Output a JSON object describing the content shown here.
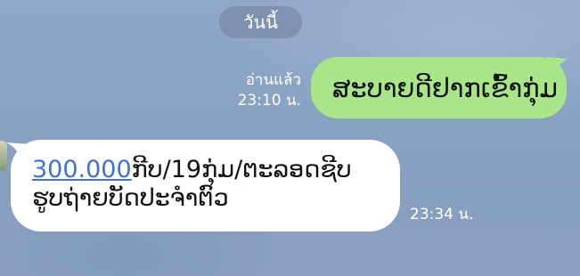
{
  "date_divider": "วันนี้",
  "outgoing_message": {
    "text": "ສະບາຍດີຢາກເຂົ້າກຸ່ມ",
    "status": "อ่านแล้ว",
    "time": "23:10 น."
  },
  "incoming_message": {
    "link_text": "300.000",
    "line1_rest": "ກີບ/19ກຸ່ມ/ຕະລອດຊີບ",
    "line2": "ຮູບຖ່າຍບັດປະຈຳຕົວ",
    "time": "23:34 น."
  },
  "colors": {
    "background": "#8ea6c7",
    "outgoing_bubble": "#a9e589",
    "incoming_bubble": "#ffffff",
    "link": "#3f6fd8"
  }
}
